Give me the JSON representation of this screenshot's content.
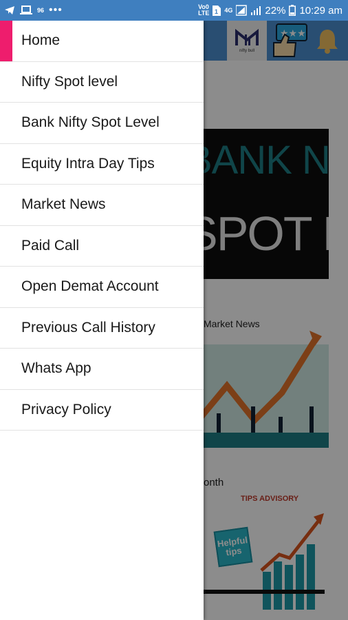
{
  "status_bar": {
    "network_label": "96",
    "volte_label": "Vo0\nLTE",
    "fourg_label": "4G",
    "battery_percent": "22%",
    "time": "10:29 am",
    "icons": [
      "telegram-icon",
      "laptop-icon",
      "signal-icon",
      "more-icon",
      "sim-icon",
      "battery-icon"
    ]
  },
  "drawer": {
    "active_index": 0,
    "items": [
      {
        "label": "Home"
      },
      {
        "label": "Nifty Spot level"
      },
      {
        "label": "Bank Nifty Spot Level"
      },
      {
        "label": "Equity Intra Day Tips"
      },
      {
        "label": "Market News"
      },
      {
        "label": "Paid Call"
      },
      {
        "label": "Open Demat Account"
      },
      {
        "label": "Previous Call History"
      },
      {
        "label": "Whats App"
      },
      {
        "label": "Privacy Policy"
      }
    ]
  },
  "background": {
    "logo_text": "nifty bull",
    "banner_line1": "BANK NIFTY",
    "banner_line2": "SPOT LEVEL",
    "card2_title": "Market News",
    "month_label": "onth",
    "tips_advisory": "TIPS ADVISORY",
    "helpful_line1": "Helpful",
    "helpful_line2": "tips",
    "colors": {
      "header": "#4c8fd0",
      "accent": "#ee1d6d",
      "teal": "#1e7f86"
    }
  }
}
